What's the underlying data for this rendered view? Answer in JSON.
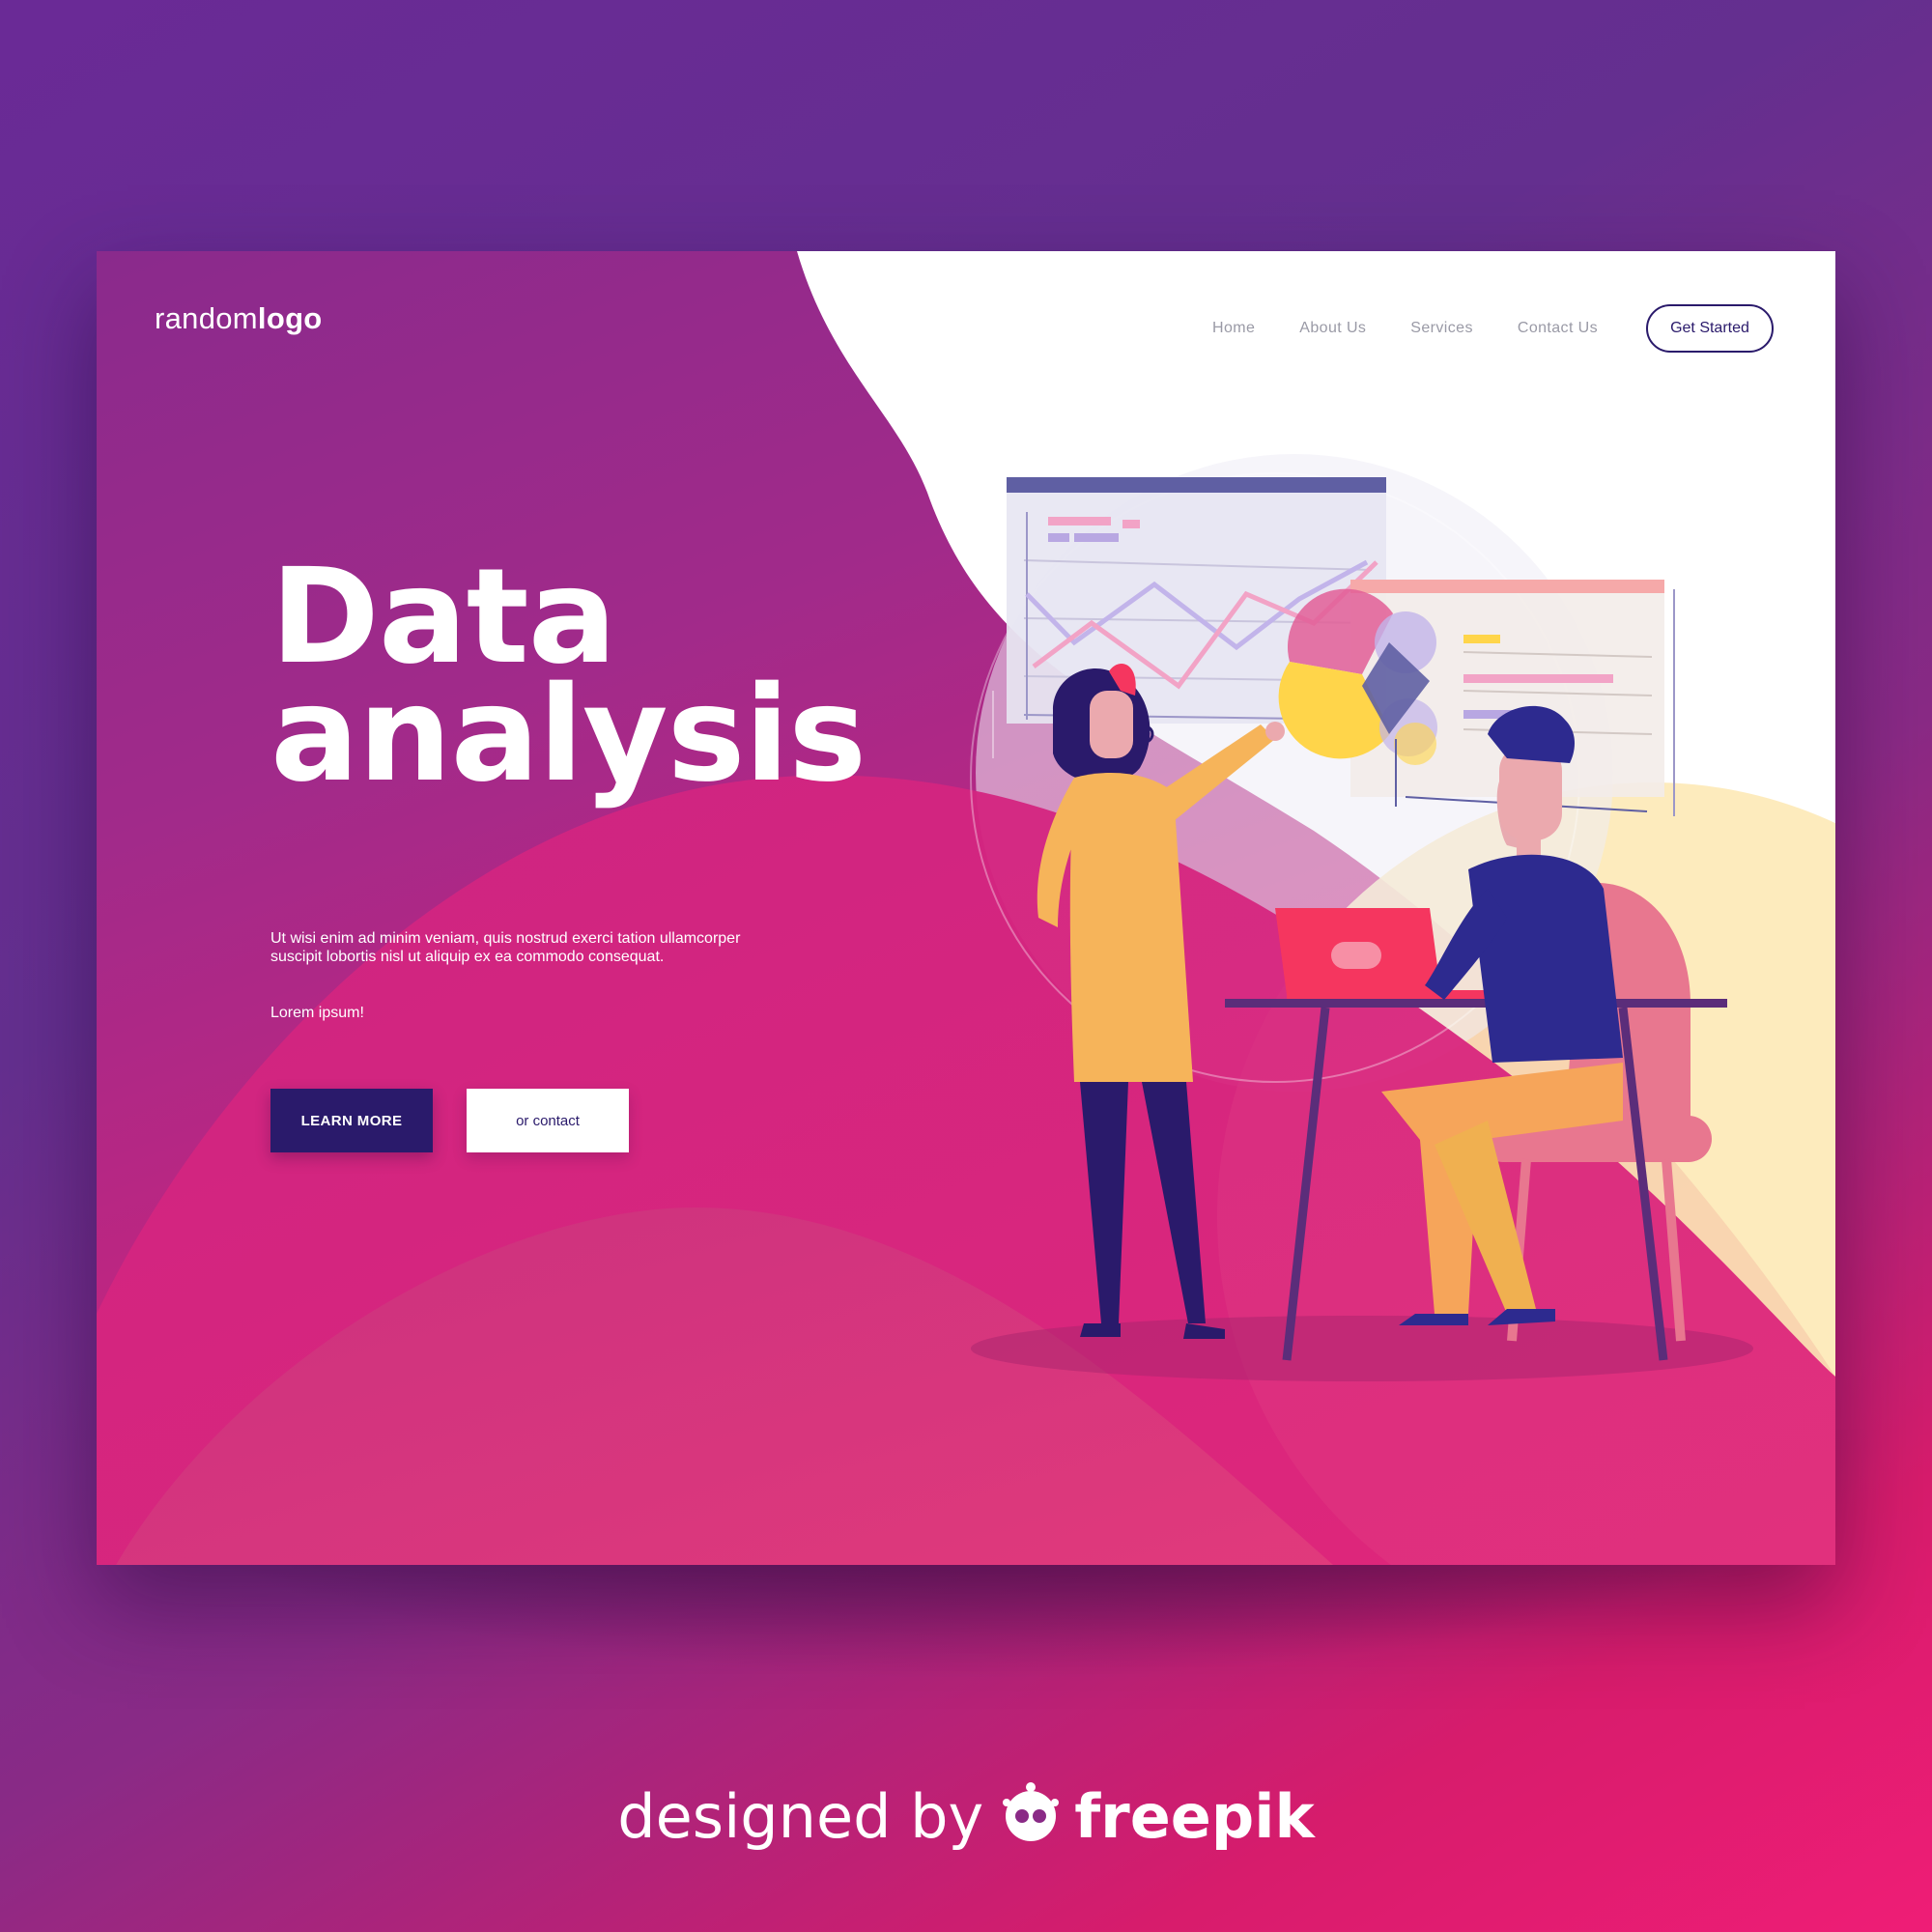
{
  "header": {
    "logo_light": "random",
    "logo_bold": "logo",
    "nav": [
      "Home",
      "About Us",
      "Services",
      "Contact Us"
    ],
    "cta": "Get Started"
  },
  "hero": {
    "title_line1": "Data",
    "title_line2": "analysis",
    "body": "Ut wisi enim ad minim veniam, quis nostrud exerci tation ullamcorper suscipit lobortis nisl ut aliquip ex ea commodo consequat.",
    "sub": "Lorem ipsum!",
    "primary_button": "LEARN MORE",
    "secondary_button": "or contact"
  },
  "credit": {
    "prefix": "designed by",
    "brand": "freepik"
  },
  "colors": {
    "navy": "#2a1a6b",
    "magenta": "#c4257f",
    "white": "#ffffff",
    "yellow": "#ffd54a",
    "nav_gray": "#9a9aa6"
  }
}
